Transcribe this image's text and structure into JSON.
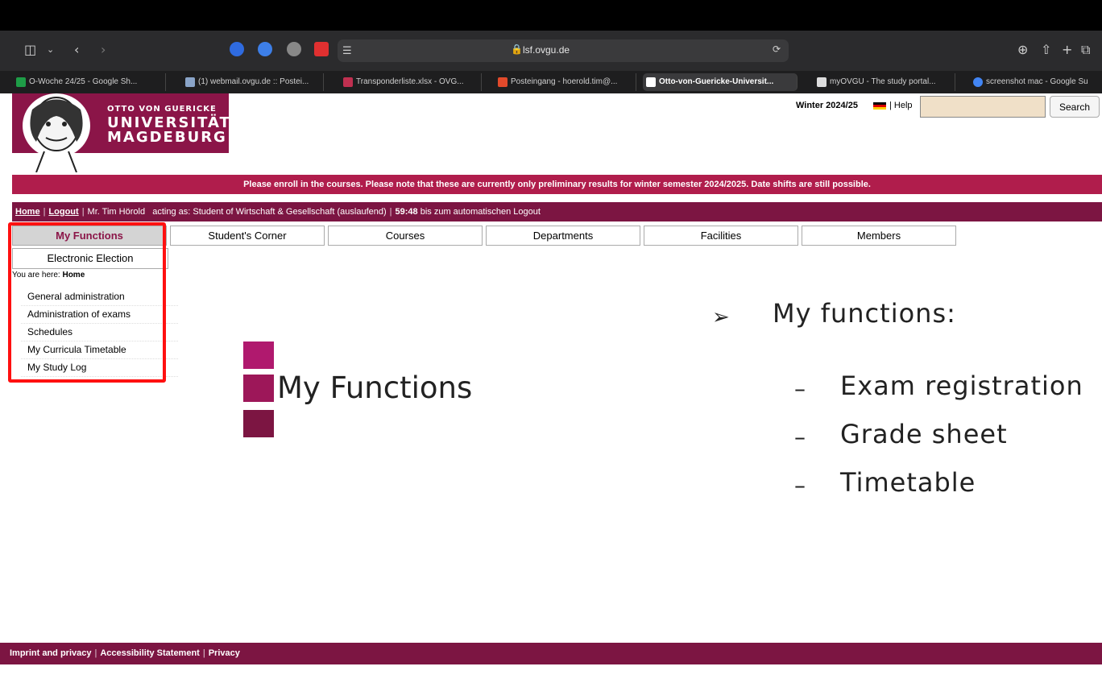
{
  "browser": {
    "address": "lsf.ovgu.de",
    "tabs": [
      {
        "label": "O-Woche 24/25 - Google Sh..."
      },
      {
        "label": "(1) webmail.ovgu.de :: Postei..."
      },
      {
        "label": "Transponderliste.xlsx - OVG..."
      },
      {
        "label": "Posteingang - hoerold.tim@..."
      },
      {
        "label": "Otto-von-Guericke-Universit..."
      },
      {
        "label": "myOVGU - The study portal..."
      },
      {
        "label": "screenshot mac - Google Su"
      }
    ]
  },
  "logo": {
    "line1": "OTTO VON GUERICKE",
    "line2": "UNIVERSITÄT",
    "line3": "MAGDEBURG"
  },
  "header": {
    "semester": "Winter 2024/25",
    "help": "| Help",
    "search_placeholder": "",
    "search_label": "Search"
  },
  "notice": "Please enroll in the courses. Please note that these are currently only preliminary results for winter semester 2024/2025. Date shifts are still possible.",
  "user_bar": {
    "home": "Home",
    "logout": "Logout",
    "user": "Mr. Tim Hörold",
    "acting": "acting as: Student of Wirtschaft & Gesellschaft (auslaufend)",
    "timer": "59:48",
    "timer_suffix": "bis zum automatischen Logout"
  },
  "nav": {
    "items": [
      {
        "label": "My Functions"
      },
      {
        "label": "Student's Corner"
      },
      {
        "label": "Courses"
      },
      {
        "label": "Departments"
      },
      {
        "label": "Facilities"
      },
      {
        "label": "Members"
      }
    ],
    "submenu": "Electronic Election"
  },
  "breadcrumb": {
    "prefix": "You are here:",
    "current": "Home"
  },
  "sidemenu": {
    "items": [
      {
        "label": "General administration"
      },
      {
        "label": "Administration of exams"
      },
      {
        "label": "Schedules"
      },
      {
        "label": "My Curricula Timetable"
      },
      {
        "label": "My Study Log"
      }
    ]
  },
  "slide": {
    "heading": "My Functions",
    "bullet": "My functions:",
    "subitems": [
      {
        "label": "Exam registration"
      },
      {
        "label": "Grade sheet"
      },
      {
        "label": "Timetable"
      }
    ]
  },
  "footer": {
    "imprint": "Imprint and privacy",
    "accessibility": "Accessibility Statement",
    "privacy": "Privacy"
  },
  "colors": {
    "brand": "#8b1548",
    "notice": "#b01d4c",
    "highlight": "#ff1010"
  }
}
